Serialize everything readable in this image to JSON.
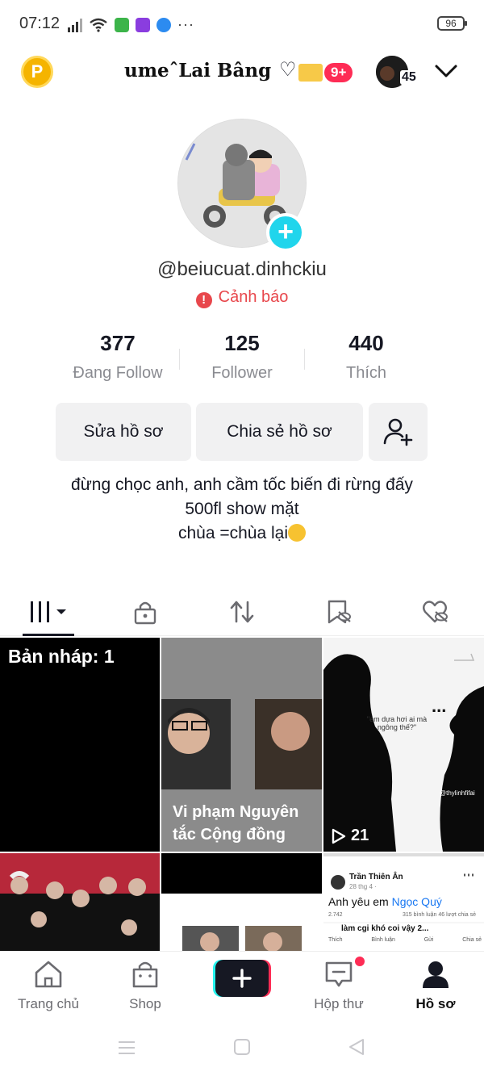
{
  "status_bar": {
    "time": "07:12",
    "battery": "96",
    "more": "···"
  },
  "header": {
    "coin_label": "P",
    "title": "umeˆLai Bâng",
    "title_deco": "♡",
    "notification_badge": "9+",
    "account_badge": "45"
  },
  "profile": {
    "username": "@beiucuat.dinhckiu",
    "warning": "Cảnh báo",
    "warning_icon": "!",
    "stats": [
      {
        "value": "377",
        "label": "Đang Follow"
      },
      {
        "value": "125",
        "label": "Follower"
      },
      {
        "value": "440",
        "label": "Thích"
      }
    ],
    "buttons": {
      "edit": "Sửa hồ sơ",
      "share": "Chia sẻ hồ sơ"
    },
    "bio": {
      "line1": "đừng chọc anh, anh cầm tốc biến đi rừng đấy",
      "line2": "500fl show mặt",
      "line3": "chùa =chùa lại"
    }
  },
  "tabs": [
    {
      "name": "videos-tab",
      "icon": "grid-icon",
      "active": true
    },
    {
      "name": "private-tab",
      "icon": "lock-icon"
    },
    {
      "name": "reposts-tab",
      "icon": "repost-icon"
    },
    {
      "name": "favorites-tab",
      "icon": "bookmark-icon"
    },
    {
      "name": "liked-tab",
      "icon": "heart-icon"
    }
  ],
  "grid": {
    "draft_label": "Bản nháp: 1",
    "violation_label_1": "Vi phạm Nguyên",
    "violation_label_2": "tắc Cộng đồng",
    "views": "21",
    "caption_quote": "\"em dựa hơi ai mà ngông thế?\"",
    "watermark": "@thylinhfifai",
    "ellipsis": "...",
    "fb_name": "Trần Thiên Ân",
    "fb_date": "28 thg 4 · ",
    "fb_text": "Anh yêu em ",
    "fb_mention": "Ngọc Quý",
    "fb_count": "2.742",
    "fb_stats": "315 bình luận  46 lượt chia sẻ",
    "fb_comment": "làm cgi khó coi vậy 2...",
    "fb_actions": [
      "Thích",
      "Bình luận",
      "Gửi",
      "Chia sẻ"
    ]
  },
  "bottom_nav": [
    {
      "label": "Trang chủ",
      "icon": "home-icon"
    },
    {
      "label": "Shop",
      "icon": "shop-icon"
    },
    {
      "label": "",
      "icon": "plus-icon"
    },
    {
      "label": "Hộp thư",
      "icon": "inbox-icon"
    },
    {
      "label": "Hồ sơ",
      "icon": "profile-icon",
      "active": true
    }
  ],
  "colors": {
    "accent_red": "#fe2c55",
    "cyan": "#20d5ec",
    "warning": "#e8474c",
    "button_bg": "#f1f1f2"
  }
}
